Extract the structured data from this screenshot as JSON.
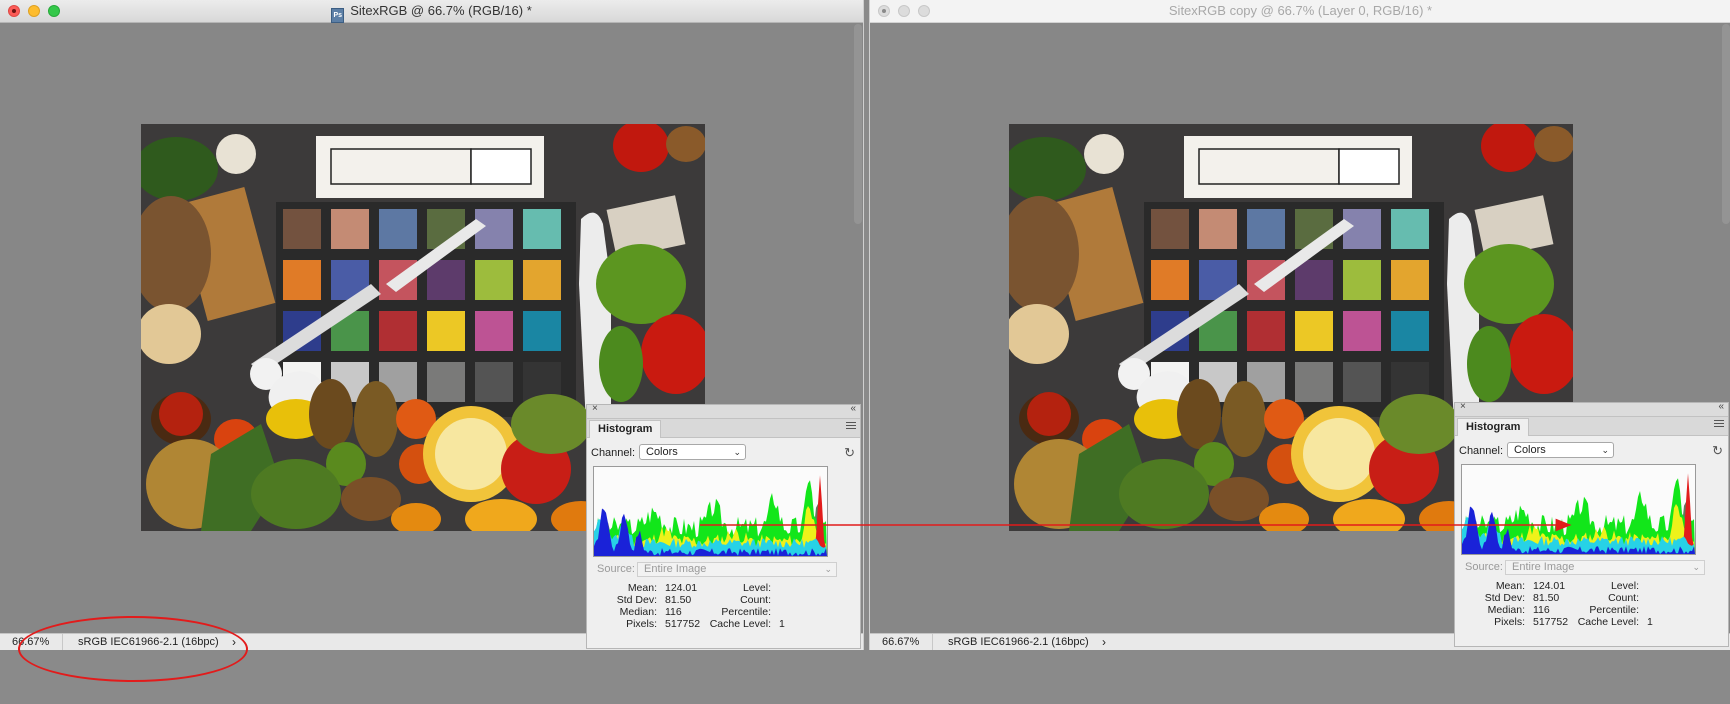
{
  "left_window": {
    "title": "SitexRGB @ 66.7% (RGB/16) *",
    "status": {
      "zoom": "66.67%",
      "profile": "sRGB IEC61966-2.1 (16bpc)"
    }
  },
  "right_window": {
    "title": "SitexRGB copy @ 66.7% (Layer 0, RGB/16) *",
    "status": {
      "zoom": "66.67%",
      "profile": "sRGB IEC61966-2.1 (16bpc)"
    }
  },
  "histogram": {
    "tab_label": "Histogram",
    "channel_label": "Channel:",
    "channel_value": "Colors",
    "source_label": "Source:",
    "source_value": "Entire Image",
    "stats": {
      "mean_label": "Mean:",
      "mean": "124.01",
      "stddev_label": "Std Dev:",
      "stddev": "81.50",
      "median_label": "Median:",
      "median": "116",
      "pixels_label": "Pixels:",
      "pixels": "517752",
      "level_label": "Level:",
      "level": "",
      "count_label": "Count:",
      "count": "",
      "percentile_label": "Percentile:",
      "percentile": "",
      "cache_label": "Cache Level:",
      "cache": "1"
    }
  },
  "icons": {
    "close": "close-icon",
    "minimize": "minimize-icon",
    "zoom": "zoom-icon",
    "panel_menu": "panel-menu-icon",
    "refresh": "refresh-icon",
    "chevron": "chevron-down-icon"
  },
  "annotation_color": "#e21b1b"
}
